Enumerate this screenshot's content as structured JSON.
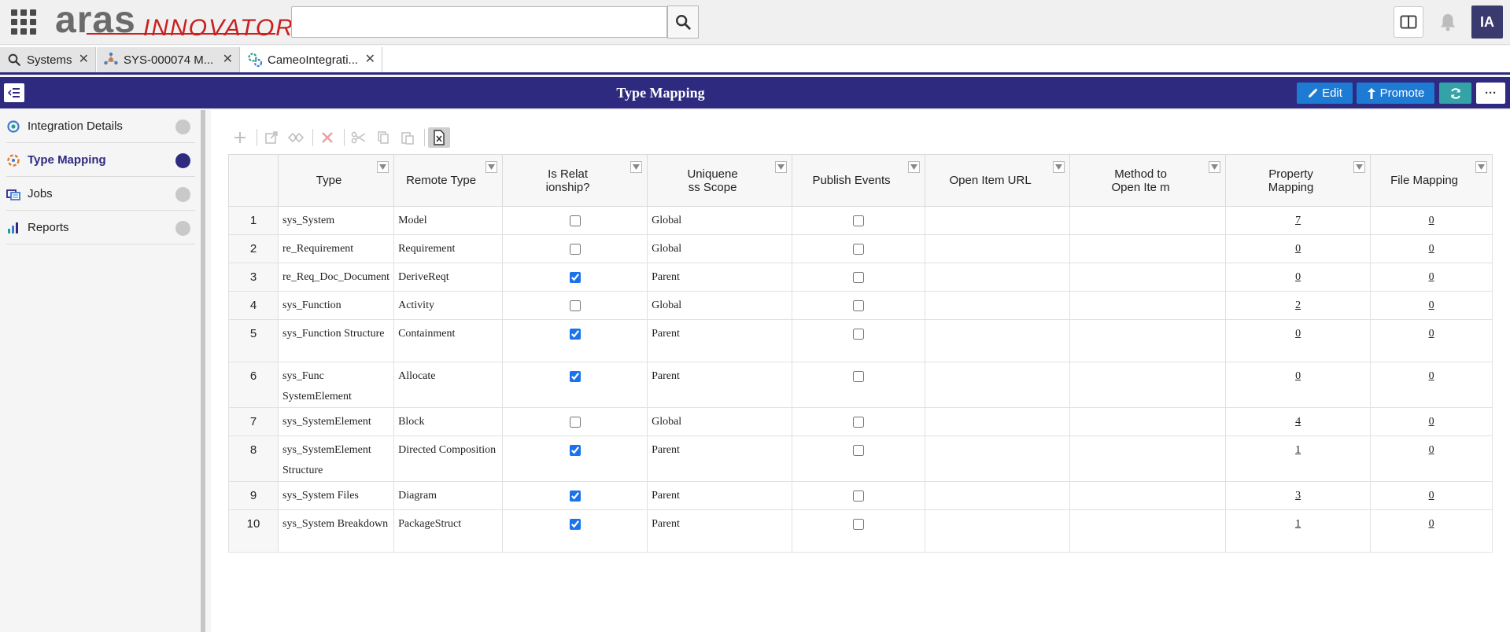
{
  "header": {
    "logo_primary": "aras",
    "logo_secondary": "INNOVATOR",
    "search": {
      "value": "",
      "placeholder": ""
    },
    "avatar_initials": "IA"
  },
  "tabs": [
    {
      "label": "Systems",
      "icon": "search-icon",
      "active": false
    },
    {
      "label": "SYS-000074 M...",
      "icon": "model-icon",
      "active": false
    },
    {
      "label": "CameoIntegrati...",
      "icon": "integration-icon",
      "active": true
    }
  ],
  "titlebar": {
    "title": "Type Mapping",
    "edit_label": "Edit",
    "promote_label": "Promote",
    "more_label": "···"
  },
  "sidebar": {
    "items": [
      {
        "label": "Integration Details",
        "icon": "integration-icon",
        "active": false
      },
      {
        "label": "Type Mapping",
        "icon": "mapping-icon",
        "active": true
      },
      {
        "label": "Jobs",
        "icon": "jobs-icon",
        "active": false
      },
      {
        "label": "Reports",
        "icon": "reports-icon",
        "active": false
      }
    ]
  },
  "grid": {
    "columns": [
      "",
      "Type",
      "Remote Type",
      "Is Relat ionship?",
      "Uniquene ss Scope",
      "Publish Events",
      "Open Item URL",
      "Method to Open Ite m",
      "Property Mapping",
      "File Mapping"
    ],
    "rows": [
      {
        "n": "1",
        "type": "sys_System",
        "remote": "Model",
        "rel": false,
        "scope": "Global",
        "publish": false,
        "url": "",
        "method": "",
        "prop": "7",
        "file": "0"
      },
      {
        "n": "2",
        "type": "re_Requirement",
        "remote": "Requirement",
        "rel": false,
        "scope": "Global",
        "publish": false,
        "url": "",
        "method": "",
        "prop": "0",
        "file": "0"
      },
      {
        "n": "3",
        "type": "re_Req_Doc_Document",
        "remote": "DeriveReqt",
        "rel": true,
        "scope": "Parent",
        "publish": false,
        "url": "",
        "method": "",
        "prop": "0",
        "file": "0"
      },
      {
        "n": "4",
        "type": "sys_Function",
        "remote": "Activity",
        "rel": false,
        "scope": "Global",
        "publish": false,
        "url": "",
        "method": "",
        "prop": "2",
        "file": "0"
      },
      {
        "n": "5",
        "type": "sys_Function Structure",
        "remote": "Containment",
        "rel": true,
        "scope": "Parent",
        "publish": false,
        "url": "",
        "method": "",
        "prop": "0",
        "file": "0"
      },
      {
        "n": "6",
        "type": "sys_Func SystemElement",
        "remote": "Allocate",
        "rel": true,
        "scope": "Parent",
        "publish": false,
        "url": "",
        "method": "",
        "prop": "0",
        "file": "0"
      },
      {
        "n": "7",
        "type": "sys_SystemElement",
        "remote": "Block",
        "rel": false,
        "scope": "Global",
        "publish": false,
        "url": "",
        "method": "",
        "prop": "4",
        "file": "0"
      },
      {
        "n": "8",
        "type": "sys_SystemElement Structure",
        "remote": "Directed Composition",
        "rel": true,
        "scope": "Parent",
        "publish": false,
        "url": "",
        "method": "",
        "prop": "1",
        "file": "0"
      },
      {
        "n": "9",
        "type": "sys_System Files",
        "remote": "Diagram",
        "rel": true,
        "scope": "Parent",
        "publish": false,
        "url": "",
        "method": "",
        "prop": "3",
        "file": "0"
      },
      {
        "n": "10",
        "type": "sys_System Breakdown",
        "remote": "PackageStruct",
        "rel": true,
        "scope": "Parent",
        "publish": false,
        "url": "",
        "method": "",
        "prop": "1",
        "file": "0"
      }
    ]
  },
  "colors": {
    "brand": "#2e2a80",
    "button_blue": "#1e7bd4",
    "button_teal": "#33a3a7",
    "logo_red": "#c8201e"
  }
}
